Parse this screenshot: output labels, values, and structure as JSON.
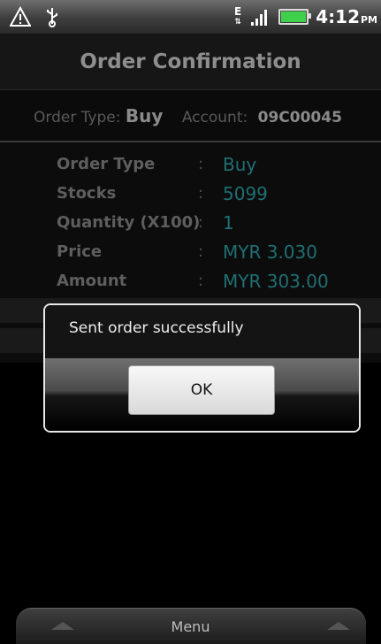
{
  "status_bar": {
    "time": "4:12",
    "ampm": "PM",
    "network_type": "E"
  },
  "header": {
    "title": "Order Confirmation"
  },
  "summary": {
    "order_type_label": "Order Type:",
    "order_type_value": "Buy",
    "account_label": "Account:",
    "account_value": "09C00045"
  },
  "details": {
    "rows": [
      {
        "label": "Order Type",
        "value": "Buy"
      },
      {
        "label": "Stocks",
        "value": "5099"
      },
      {
        "label": "Quantity (X100)",
        "value": "1"
      },
      {
        "label": "Price",
        "value": "MYR 3.030"
      },
      {
        "label": "Amount",
        "value": "MYR 303.00"
      }
    ],
    "separator": ":"
  },
  "dialog": {
    "message": "Sent order successfully",
    "ok_label": "OK"
  },
  "menu_bar": {
    "label": "Menu"
  },
  "colors": {
    "value_teal": "#1f6f73",
    "battery_green": "#3fd04b"
  }
}
